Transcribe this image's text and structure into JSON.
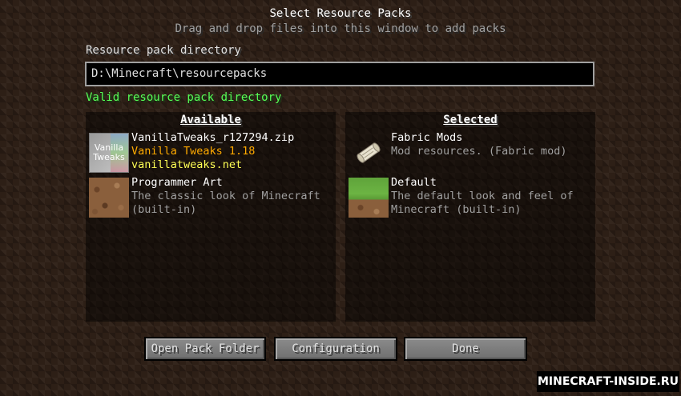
{
  "header": {
    "title": "Select Resource Packs",
    "subtitle": "Drag and drop files into this window to add packs"
  },
  "directory": {
    "label": "Resource pack directory",
    "value": "D:\\Minecraft\\resourcepacks",
    "status": "Valid resource pack directory"
  },
  "available": {
    "heading": "Available",
    "items": [
      {
        "name": "VanillaTweaks_r127294.zip",
        "line1": "Vanilla Tweaks 1.18",
        "line2": "vanillatweaks.net",
        "thumb_text1": "Vanilla",
        "thumb_text2": "Tweaks",
        "icon": "vanilla-tweaks-pack-icon"
      },
      {
        "name": "Programmer Art",
        "line1": "The classic look of Minecraft",
        "line2": "(built-in)",
        "icon": "dirt-block-icon"
      }
    ]
  },
  "selected": {
    "heading": "Selected",
    "items": [
      {
        "name": "Fabric Mods",
        "line1": "Mod resources. (Fabric mod)",
        "icon": "scroll-icon"
      },
      {
        "name": "Default",
        "line1": "The default look and feel of",
        "line2": "Minecraft (built-in)",
        "icon": "grass-block-icon"
      }
    ]
  },
  "buttons": {
    "open_folder": "Open Pack Folder",
    "configuration": "Configuration",
    "done": "Done"
  },
  "watermark": "MINECRAFT-INSIDE.RU",
  "colors": {
    "valid_text": "#55ff55",
    "pack_title_gold": "#ffaa00",
    "pack_link_yellow": "#ffff55",
    "description_gray": "#a0a0a0"
  }
}
